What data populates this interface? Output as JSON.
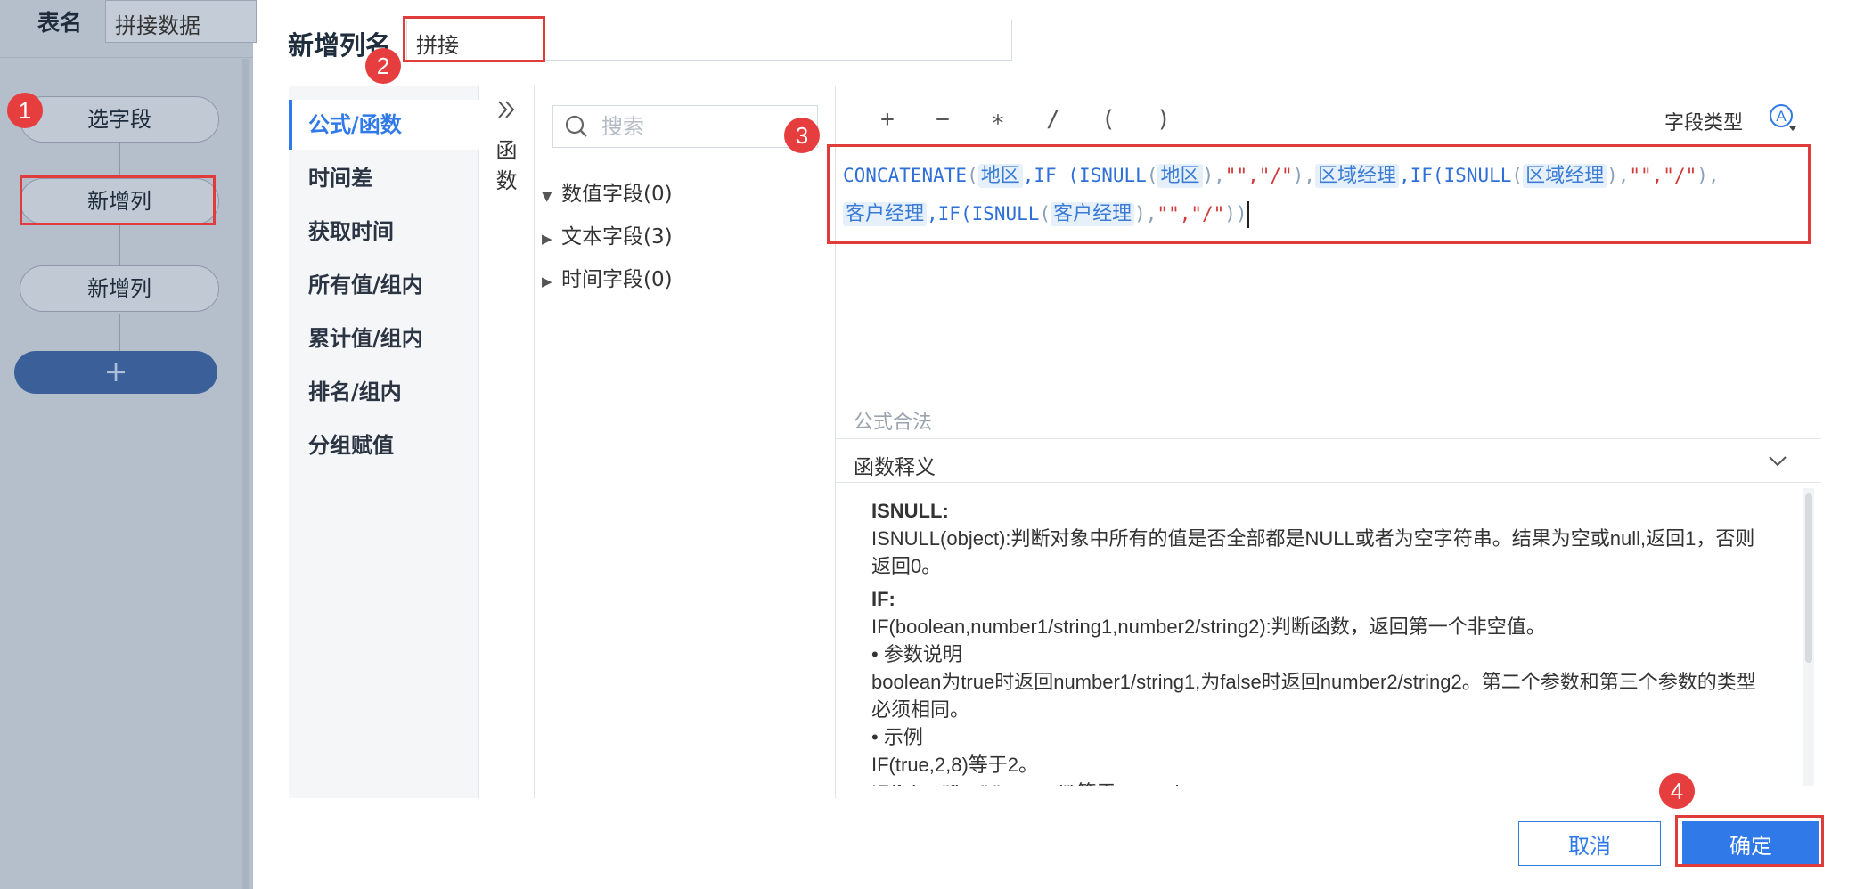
{
  "left_panel": {
    "table_name_label": "表名",
    "table_name_value": "拼接数据",
    "steps": [
      "选字段",
      "新增列",
      "新增列"
    ],
    "add_step_label": "+"
  },
  "header": {
    "new_column_label": "新增列名",
    "new_column_value": "拼接"
  },
  "categories": [
    "公式/函数",
    "时间差",
    "获取时间",
    "所有值/组内",
    "累计值/组内",
    "排名/组内",
    "分组赋值"
  ],
  "function_strip": {
    "expand_icon": "double-chevron-right-icon",
    "label_line1": "函",
    "label_line2": "数"
  },
  "fields": {
    "search_placeholder": "搜索",
    "groups": [
      {
        "label": "数值字段(0)",
        "expanded": true
      },
      {
        "label": "文本字段(3)",
        "expanded": false
      },
      {
        "label": "时间字段(0)",
        "expanded": false
      }
    ]
  },
  "formula": {
    "operators": [
      "+",
      "−",
      "∗",
      "/",
      "(",
      ")"
    ],
    "field_type_label": "字段类型",
    "field_type_icon": "A",
    "tokens_line1": [
      {
        "t": "CONCATENATE",
        "c": "fn"
      },
      {
        "t": "(",
        "c": "paren"
      },
      {
        "t": "地区",
        "c": "fld"
      },
      {
        "t": ",IF (ISNULL",
        "c": "fn"
      },
      {
        "t": "(",
        "c": "paren"
      },
      {
        "t": "地区",
        "c": "fld"
      },
      {
        "t": "),",
        "c": "paren"
      },
      {
        "t": "\"\",\"/\"",
        "c": "str"
      },
      {
        "t": "),",
        "c": "paren"
      },
      {
        "t": "区域经理",
        "c": "fld"
      },
      {
        "t": ",IF(ISNULL",
        "c": "fn"
      },
      {
        "t": "(",
        "c": "paren"
      },
      {
        "t": "区域经理",
        "c": "fld"
      },
      {
        "t": "),",
        "c": "paren"
      },
      {
        "t": "\"\",\"/\"",
        "c": "str"
      },
      {
        "t": "),",
        "c": "paren"
      }
    ],
    "tokens_line2": [
      {
        "t": "客户经理",
        "c": "fld"
      },
      {
        "t": ",IF(ISNULL",
        "c": "fn"
      },
      {
        "t": "(",
        "c": "paren"
      },
      {
        "t": "客户经理",
        "c": "fld"
      },
      {
        "t": "),",
        "c": "paren"
      },
      {
        "t": "\"\",\"/\"",
        "c": "str"
      },
      {
        "t": "))",
        "c": "paren"
      }
    ],
    "validity_text": "公式合法",
    "help_title": "函数释义",
    "help_lines": [
      {
        "b": true,
        "t": "ISNULL:"
      },
      {
        "b": false,
        "t": "ISNULL(object):判断对象中所有的值是否全部都是NULL或者为空字符串。结果为空或null,返回1，否则返回0。"
      },
      {
        "b": true,
        "t": "IF:"
      },
      {
        "b": false,
        "t": "IF(boolean,number1/string1,number2/string2):判断函数，返回第一个非空值。"
      },
      {
        "b": false,
        "t": "• 参数说明"
      },
      {
        "b": false,
        "t": "boolean为true时返回number1/string1,为false时返回number2/string2。第二个参数和第三个参数的类型必须相同。"
      },
      {
        "b": false,
        "t": "• 示例"
      },
      {
        "b": false,
        "t": "IF(true,2,8)等于2。"
      },
      {
        "b": false,
        "t": "IF(false,\"first\",\"second\")等于second 。"
      }
    ]
  },
  "footer": {
    "cancel_label": "取消",
    "ok_label": "确定"
  },
  "badges": [
    "1",
    "2",
    "3",
    "4"
  ],
  "colors": {
    "accent": "#2f79e8",
    "highlight": "#e03c3c",
    "badge": "#e63e3e"
  }
}
